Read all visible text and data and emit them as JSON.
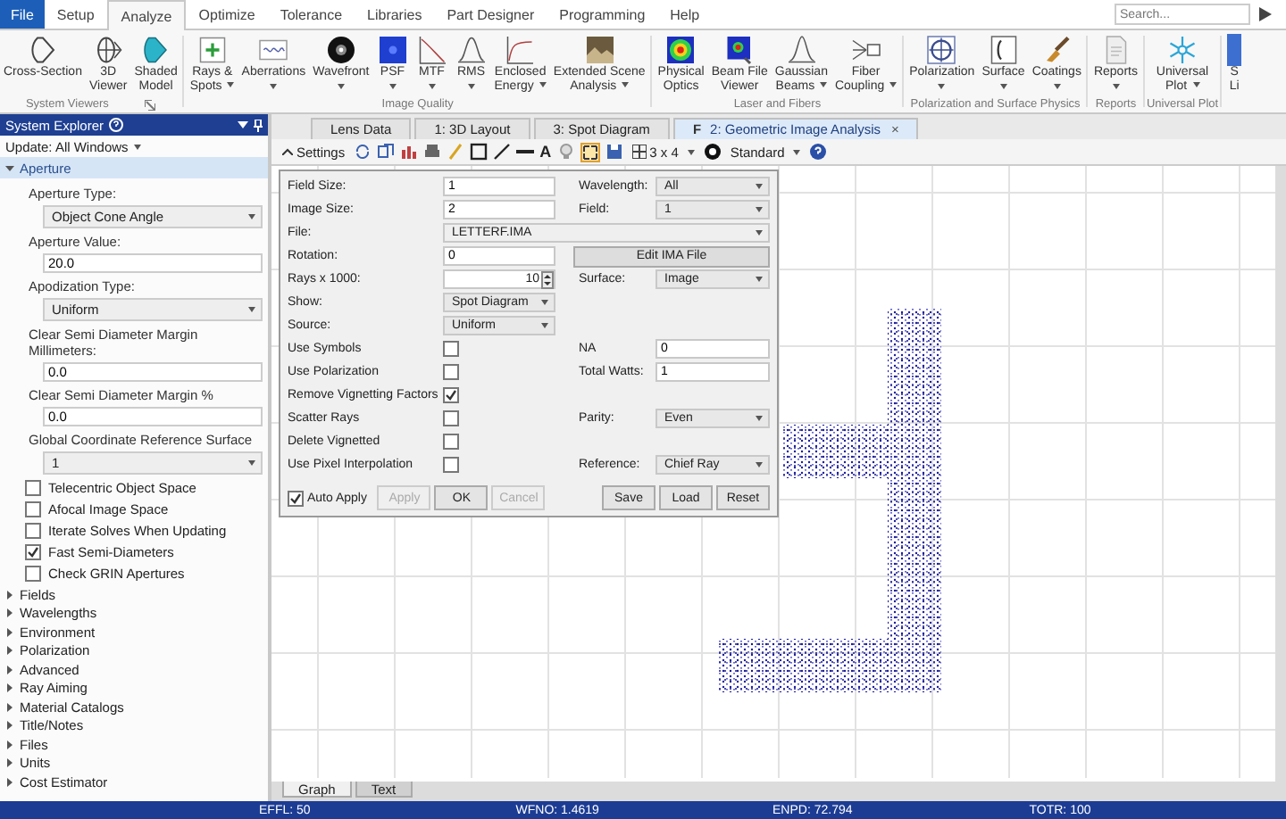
{
  "menu_tabs": [
    {
      "label": "File",
      "kind": "file",
      "selected": false
    },
    {
      "label": "Setup",
      "kind": "tab",
      "selected": false
    },
    {
      "label": "Analyze",
      "kind": "tab",
      "selected": true
    },
    {
      "label": "Optimize",
      "kind": "tab",
      "selected": false
    },
    {
      "label": "Tolerance",
      "kind": "tab",
      "selected": false
    },
    {
      "label": "Libraries",
      "kind": "tab",
      "selected": false
    },
    {
      "label": "Part Designer",
      "kind": "tab",
      "selected": false
    },
    {
      "label": "Programming",
      "kind": "tab",
      "selected": false
    },
    {
      "label": "Help",
      "kind": "tab",
      "selected": false
    }
  ],
  "search": {
    "placeholder": "Search..."
  },
  "ribbon_groups": [
    {
      "label": "System Viewers",
      "buttons": [
        {
          "label": "Cross-Section",
          "dropdown": false
        },
        {
          "label": "3D\nViewer",
          "dropdown": false
        },
        {
          "label": "Shaded\nModel",
          "dropdown": false
        }
      ]
    },
    {
      "label": "Image Quality",
      "buttons": [
        {
          "label": "Rays &\nSpots",
          "dropdown": true
        },
        {
          "label": "Aberrations",
          "dropdown": true
        },
        {
          "label": "Wavefront",
          "dropdown": true
        },
        {
          "label": "PSF",
          "dropdown": true
        },
        {
          "label": "MTF",
          "dropdown": true
        },
        {
          "label": "RMS",
          "dropdown": true
        },
        {
          "label": "Enclosed\nEnergy",
          "dropdown": true
        },
        {
          "label": "Extended Scene\nAnalysis",
          "dropdown": true
        }
      ]
    },
    {
      "label": "Laser and Fibers",
      "buttons": [
        {
          "label": "Physical\nOptics",
          "dropdown": false
        },
        {
          "label": "Beam File\nViewer",
          "dropdown": false
        },
        {
          "label": "Gaussian\nBeams",
          "dropdown": true
        },
        {
          "label": "Fiber\nCoupling",
          "dropdown": true
        }
      ]
    },
    {
      "label": "Polarization and Surface Physics",
      "buttons": [
        {
          "label": "Polarization",
          "dropdown": true
        },
        {
          "label": "Surface",
          "dropdown": true
        },
        {
          "label": "Coatings",
          "dropdown": true
        }
      ]
    },
    {
      "label": "Reports",
      "buttons": [
        {
          "label": "Reports",
          "dropdown": true
        }
      ]
    },
    {
      "label": "Universal Plot",
      "buttons": [
        {
          "label": "Universal\nPlot",
          "dropdown": true
        }
      ]
    },
    {
      "buttons": [
        {
          "label": "S\nLi",
          "dropdown": false
        }
      ]
    }
  ],
  "system_explorer": {
    "title": "System Explorer",
    "update": "Update: All Windows",
    "sections": [
      {
        "label": "Aperture",
        "expanded": true,
        "items": [
          {
            "kind": "label",
            "text": "Aperture Type:"
          },
          {
            "kind": "select",
            "text": "Object Cone Angle"
          },
          {
            "kind": "label",
            "text": "Aperture Value:"
          },
          {
            "kind": "input",
            "text": "20.0"
          },
          {
            "kind": "label",
            "text": "Apodization Type:"
          },
          {
            "kind": "select",
            "text": "Uniform"
          },
          {
            "kind": "label",
            "text": "Clear Semi Diameter Margin Millimeters:"
          },
          {
            "kind": "input",
            "text": "0.0"
          },
          {
            "kind": "label",
            "text": "Clear Semi Diameter Margin %"
          },
          {
            "kind": "input",
            "text": "0.0"
          },
          {
            "kind": "label",
            "text": "Global Coordinate Reference Surface"
          },
          {
            "kind": "select",
            "text": "1"
          },
          {
            "kind": "checkbox",
            "text": "Telecentric Object Space",
            "checked": false
          },
          {
            "kind": "checkbox",
            "text": "Afocal Image Space",
            "checked": false
          },
          {
            "kind": "checkbox",
            "text": "Iterate Solves When Updating",
            "checked": false
          },
          {
            "kind": "checkbox",
            "text": "Fast Semi-Diameters",
            "checked": true
          },
          {
            "kind": "checkbox",
            "text": "Check GRIN Apertures",
            "checked": false
          }
        ]
      },
      {
        "label": "Fields",
        "expanded": false
      },
      {
        "label": "Wavelengths",
        "expanded": false
      },
      {
        "label": "Environment",
        "expanded": false
      },
      {
        "label": "Polarization",
        "expanded": false
      },
      {
        "label": "Advanced",
        "expanded": false
      },
      {
        "label": "Ray Aiming",
        "expanded": false
      },
      {
        "label": "Material Catalogs",
        "expanded": false
      },
      {
        "label": "Title/Notes",
        "expanded": false
      },
      {
        "label": "Files",
        "expanded": false
      },
      {
        "label": "Units",
        "expanded": false
      },
      {
        "label": "Cost Estimator",
        "expanded": false
      }
    ]
  },
  "doc_tabs": [
    {
      "label": "Lens Data",
      "selected": false
    },
    {
      "label": "1: 3D Layout",
      "selected": false
    },
    {
      "label": "3: Spot Diagram",
      "selected": false
    },
    {
      "label": "2: Geometric Image Analysis",
      "badge": "F",
      "close": "×",
      "selected": true
    }
  ],
  "toolbar": {
    "settings": "Settings",
    "text_tool": "A",
    "layout": "3 x 4",
    "mode": "Standard"
  },
  "dialog": {
    "rows": [
      {
        "left": {
          "label": "Field Size:",
          "kind": "input",
          "value": "1"
        },
        "right": {
          "label": "Wavelength:",
          "kind": "select",
          "value": "All"
        }
      },
      {
        "left": {
          "label": "Image Size:",
          "kind": "input",
          "value": "2"
        },
        "right": {
          "label": "Field:",
          "kind": "select",
          "value": "1"
        }
      },
      {
        "left": {
          "label": "File:",
          "kind": "wide_select",
          "value": "LETTERF.IMA"
        }
      },
      {
        "left": {
          "label": "Rotation:",
          "kind": "input",
          "value": "0"
        },
        "right": {
          "kind": "button",
          "value": "Edit IMA File"
        }
      },
      {
        "left": {
          "label": "Rays x 1000:",
          "kind": "spinner",
          "value": "10"
        },
        "right": {
          "label": "Surface:",
          "kind": "select",
          "value": "Image"
        }
      },
      {
        "left": {
          "label": "Show:",
          "kind": "select",
          "value": "Spot Diagram"
        }
      },
      {
        "left": {
          "label": "Source:",
          "kind": "select",
          "value": "Uniform"
        }
      },
      {
        "left": {
          "label": "Use Symbols",
          "kind": "checkbox",
          "checked": false
        },
        "right": {
          "label": "NA",
          "kind": "input",
          "value": "0"
        }
      },
      {
        "left": {
          "label": "Use Polarization",
          "kind": "checkbox",
          "checked": false
        },
        "right": {
          "label": "Total Watts:",
          "kind": "input",
          "value": "1"
        }
      },
      {
        "left": {
          "label": "Remove Vignetting Factors",
          "kind": "checkbox",
          "checked": true
        }
      },
      {
        "left": {
          "label": "Scatter Rays",
          "kind": "checkbox",
          "checked": false
        },
        "right": {
          "label": "Parity:",
          "kind": "select",
          "value": "Even"
        }
      },
      {
        "left": {
          "label": "Delete Vignetted",
          "kind": "checkbox",
          "checked": false
        }
      },
      {
        "left": {
          "label": "Use Pixel Interpolation",
          "kind": "checkbox",
          "checked": false
        },
        "right": {
          "label": "Reference:",
          "kind": "select",
          "value": "Chief Ray"
        }
      }
    ],
    "auto_apply": {
      "label": "Auto Apply",
      "checked": true
    },
    "buttons": [
      {
        "label": "Apply",
        "disabled": true
      },
      {
        "label": "OK",
        "disabled": false
      },
      {
        "label": "Cancel",
        "disabled": true
      }
    ],
    "file_buttons": [
      {
        "label": "Save",
        "disabled": false
      },
      {
        "label": "Load",
        "disabled": false
      },
      {
        "label": "Reset",
        "disabled": false
      }
    ]
  },
  "bottom_tabs": [
    {
      "label": "Graph",
      "selected": true
    },
    {
      "label": "Text",
      "selected": false
    }
  ],
  "status_bar": [
    "EFFL: 50",
    "WFNO: 1.4619",
    "ENPD: 72.794",
    "TOTR: 100"
  ]
}
